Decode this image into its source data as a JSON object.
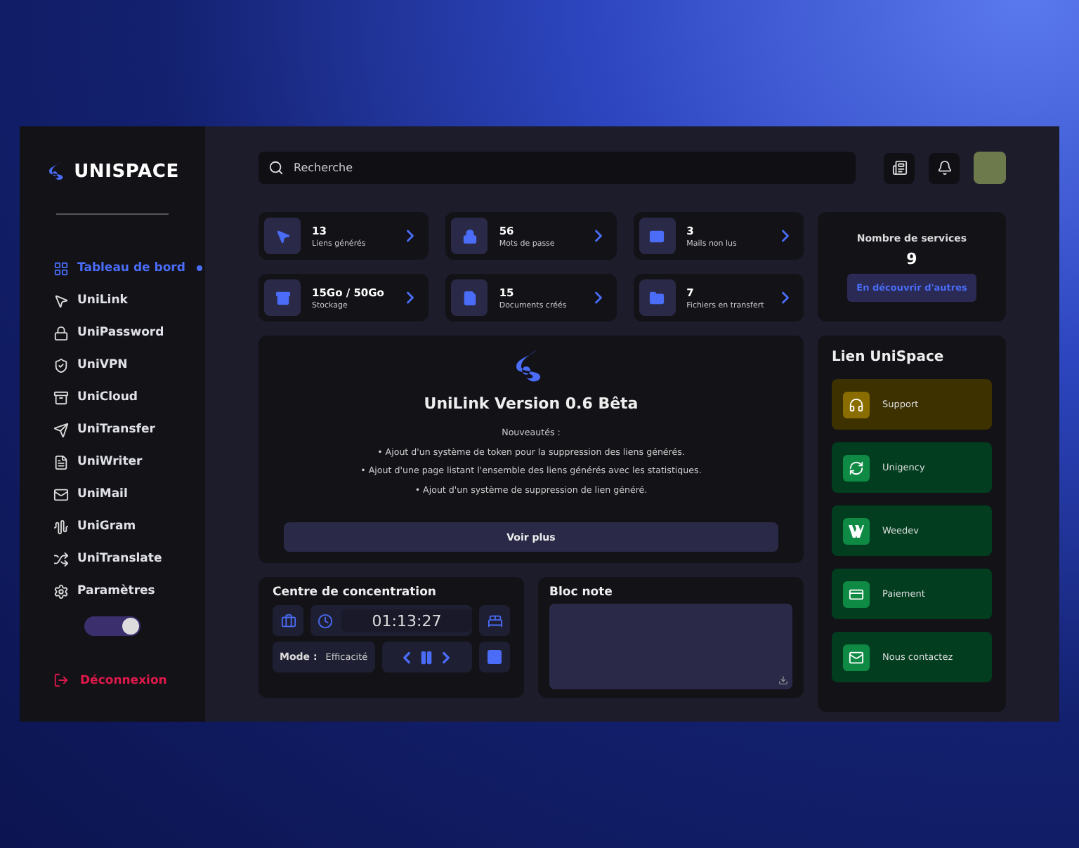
{
  "brand": {
    "name": "UNISPACE"
  },
  "sidebar": {
    "items": [
      {
        "label": "Tableau de bord",
        "selected": true
      },
      {
        "label": "UniLink",
        "selected": false
      },
      {
        "label": "UniPassword",
        "selected": false
      },
      {
        "label": "UniVPN",
        "selected": false
      },
      {
        "label": "UniCloud",
        "selected": false
      },
      {
        "label": "UniTransfer",
        "selected": false
      },
      {
        "label": "UniWriter",
        "selected": false
      },
      {
        "label": "UniMail",
        "selected": false
      },
      {
        "label": "UniGram",
        "selected": false
      },
      {
        "label": "UniTranslate",
        "selected": false
      },
      {
        "label": "Paramètres",
        "selected": false
      }
    ],
    "dark_mode": {
      "on": true
    },
    "logout": "Déconnexion"
  },
  "search": {
    "placeholder": "Recherche"
  },
  "stats": [
    {
      "value": "13",
      "label": "Liens générés"
    },
    {
      "value": "56",
      "label": "Mots de passe"
    },
    {
      "value": "3",
      "label": "Mails non lus"
    },
    {
      "value": "15Go / 50Go",
      "label": "Stockage"
    },
    {
      "value": "15",
      "label": "Documents créés"
    },
    {
      "value": "7",
      "label": "Fichiers en transfert"
    }
  ],
  "services": {
    "title": "Nombre de services",
    "count": "9",
    "button": "En découvrir d'autres"
  },
  "release": {
    "title": "UniLink Version 0.6 Bêta",
    "subtitle": "Nouveautés :",
    "items": [
      "•  Ajout d'un système de token pour la suppression des liens générés.",
      "•  Ajout d'une page listant l'ensemble des liens générés avec les statistiques.",
      "•  Ajout d'un système de suppression de lien généré."
    ],
    "button": "Voir plus"
  },
  "focus": {
    "title": "Centre de concentration",
    "timer": "01:13:27",
    "mode_label": "Mode :",
    "mode_value": "Efficacité",
    "paused": false
  },
  "notes": {
    "title": "Bloc note"
  },
  "links": {
    "title": "Lien UniSpace",
    "items": [
      {
        "label": "Support",
        "color": "#3d3100"
      },
      {
        "label": "Unigency",
        "color": "#013d1e"
      },
      {
        "label": "Weedev",
        "color": "#013d1e"
      },
      {
        "label": "Paiement",
        "color": "#013d1e"
      },
      {
        "label": "Nous contactez",
        "color": "#013d1e"
      }
    ]
  }
}
